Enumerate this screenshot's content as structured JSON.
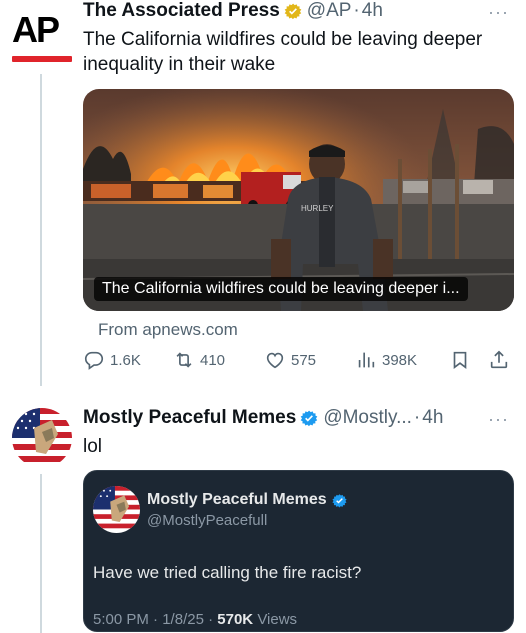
{
  "tweet1": {
    "logo_text": "AP",
    "author_name": "The Associated Press",
    "handle": "@AP",
    "separator": "·",
    "time": "4h",
    "more": "···",
    "body": "The California wildfires could be leaving deeper inequality in their wake",
    "card_caption": "The California wildfires could be leaving deeper i...",
    "from_source": "From apnews.com",
    "metrics": {
      "replies": "1.6K",
      "reposts": "410",
      "likes": "575",
      "views": "398K"
    },
    "shirt_text": "HURLEY"
  },
  "tweet2": {
    "author_name": "Mostly Peaceful Memes",
    "handle": "@Mostly...",
    "separator": "·",
    "time": "4h",
    "more": "···",
    "body": "lol",
    "quote": {
      "author_name": "Mostly Peaceful Memes",
      "handle": "@MostlyPeacefull",
      "body": "Have we tried calling the fire racist?",
      "time": "5:00 PM",
      "date": "1/8/25",
      "views_count": "570K",
      "views_label": "Views",
      "sep": "·"
    }
  },
  "colors": {
    "verified_gold": "#e2b719",
    "verified_blue": "#1d9bf0",
    "ap_red": "#e0242b",
    "muted": "#536471"
  }
}
